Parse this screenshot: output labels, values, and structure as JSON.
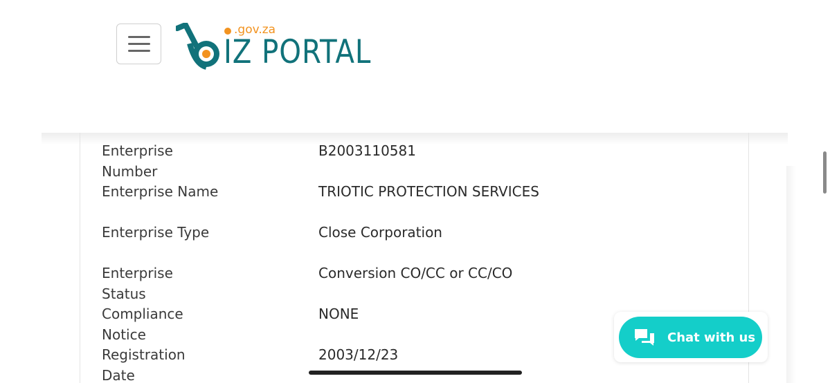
{
  "header": {
    "menu_icon": "hamburger-menu-icon",
    "logo": {
      "domain_text": ".gov.za",
      "word_text": "IZ PORTAL",
      "colors": {
        "teal": "#11727a",
        "orange": "#f29320"
      }
    }
  },
  "details": {
    "rows": [
      {
        "label": "Enterprise Number",
        "value": "B2003110581"
      },
      {
        "label": "Enterprise Name",
        "value": "TRIOTIC PROTECTION SERVICES"
      },
      {
        "label": "Enterprise Type",
        "value": "Close Corporation"
      },
      {
        "label": "Enterprise Status",
        "value": "Conversion CO/CC or CC/CO"
      },
      {
        "label": "Compliance Notice",
        "value": "NONE"
      },
      {
        "label": "Registration Date",
        "value": "2003/12/23"
      }
    ]
  },
  "chat": {
    "label": "Chat with us",
    "icon": "chat-bubbles-icon",
    "color": "#14cec9"
  }
}
